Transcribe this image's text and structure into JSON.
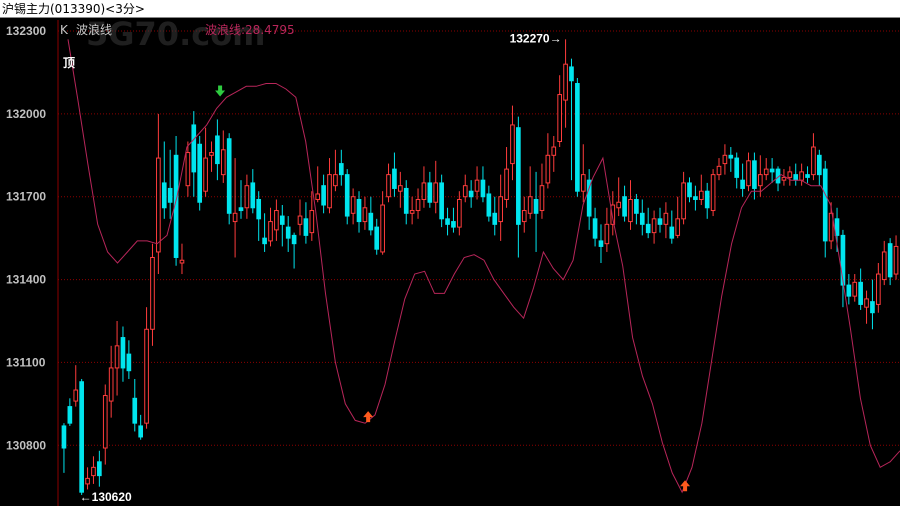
{
  "window": {
    "title": "沪锡主力(013390)<3分>"
  },
  "legend": {
    "k_label": "K",
    "indicator_name": "波浪线",
    "indicator_value_text": "波浪线:28.4795"
  },
  "watermark": "5G70.com",
  "colors": {
    "bg": "#000000",
    "up": "#ff3c3c",
    "down": "#00e5ee",
    "wave": "#b8265a",
    "grid": "#8b0000",
    "arrow_up": "#ff5a1e",
    "arrow_sell": "#2ecc40"
  },
  "signals": {
    "top_label": "顶",
    "buy_icon": "arrow-up-orange-icon",
    "sell_icon": "arrow-down-green-icon"
  },
  "chart_data": {
    "type": "candlestick",
    "yaxis": {
      "ticks": [
        132300,
        132000,
        131700,
        131400,
        131100,
        130800
      ],
      "ylim": [
        130580,
        132340
      ]
    },
    "annotations": {
      "high_text": "132270→",
      "high_value": 132270,
      "low_text": "←130620",
      "low_value": 130620
    },
    "candles": [
      [
        130870,
        130790,
        130880,
        130700
      ],
      [
        130940,
        130880,
        130970,
        130870
      ],
      [
        130960,
        131000,
        131090,
        130940
      ],
      [
        131030,
        130630,
        131040,
        130620
      ],
      [
        130660,
        130680,
        130720,
        130640
      ],
      [
        130690,
        130720,
        130760,
        130660
      ],
      [
        130740,
        130690,
        130780,
        130650
      ],
      [
        130790,
        130980,
        131020,
        130730
      ],
      [
        130960,
        131080,
        131160,
        130900
      ],
      [
        131080,
        131160,
        131250,
        130980
      ],
      [
        131190,
        131080,
        131230,
        131030
      ],
      [
        131130,
        131070,
        131180,
        131040
      ],
      [
        130970,
        130880,
        131040,
        130850
      ],
      [
        130870,
        130830,
        130910,
        130820
      ],
      [
        130880,
        131220,
        131300,
        130860
      ],
      [
        131220,
        131480,
        131530,
        131160
      ],
      [
        131500,
        131840,
        132000,
        131420
      ],
      [
        131750,
        131660,
        131900,
        131620
      ],
      [
        131730,
        131680,
        131870,
        131620
      ],
      [
        131850,
        131480,
        131920,
        131450
      ],
      [
        131460,
        131470,
        131530,
        131420
      ],
      [
        131740,
        131860,
        131900,
        131700
      ],
      [
        131960,
        131790,
        132010,
        131700
      ],
      [
        131890,
        131680,
        131920,
        131650
      ],
      [
        131720,
        131840,
        131950,
        131700
      ],
      [
        131850,
        131860,
        131900,
        131790
      ],
      [
        131920,
        131820,
        131980,
        131760
      ],
      [
        131780,
        131870,
        131940,
        131750
      ],
      [
        131910,
        131640,
        131930,
        131600
      ],
      [
        131610,
        131640,
        131840,
        131480
      ],
      [
        131660,
        131650,
        131760,
        131620
      ],
      [
        131660,
        131740,
        131780,
        131620
      ],
      [
        131750,
        131660,
        131800,
        131640
      ],
      [
        131690,
        131620,
        131720,
        131540
      ],
      [
        131550,
        131530,
        131640,
        131500
      ],
      [
        131540,
        131610,
        131660,
        131520
      ],
      [
        131580,
        131650,
        131690,
        131540
      ],
      [
        131630,
        131600,
        131670,
        131520
      ],
      [
        131590,
        131550,
        131630,
        131500
      ],
      [
        131560,
        131530,
        131570,
        131440
      ],
      [
        131600,
        131630,
        131690,
        131560
      ],
      [
        131620,
        131560,
        131680,
        131530
      ],
      [
        131570,
        131650,
        131720,
        131540
      ],
      [
        131690,
        131710,
        131810,
        131680
      ],
      [
        131740,
        131670,
        131780,
        131640
      ],
      [
        131660,
        131780,
        131840,
        131640
      ],
      [
        131740,
        131780,
        131870,
        131720
      ],
      [
        131820,
        131780,
        131870,
        131740
      ],
      [
        131780,
        131630,
        131800,
        131600
      ],
      [
        131640,
        131700,
        131730,
        131600
      ],
      [
        131690,
        131610,
        131720,
        131570
      ],
      [
        131610,
        131660,
        131700,
        131580
      ],
      [
        131640,
        131580,
        131700,
        131560
      ],
      [
        131590,
        131510,
        131620,
        131490
      ],
      [
        131500,
        131670,
        131720,
        131490
      ],
      [
        131700,
        131780,
        131820,
        131680
      ],
      [
        131800,
        131730,
        131860,
        131700
      ],
      [
        131720,
        131740,
        131790,
        131660
      ],
      [
        131730,
        131640,
        131760,
        131600
      ],
      [
        131640,
        131650,
        131700,
        131600
      ],
      [
        131650,
        131690,
        131730,
        131620
      ],
      [
        131690,
        131750,
        131810,
        131660
      ],
      [
        131750,
        131680,
        131790,
        131660
      ],
      [
        131680,
        131750,
        131830,
        131640
      ],
      [
        131750,
        131620,
        131780,
        131590
      ],
      [
        131620,
        131600,
        131660,
        131560
      ],
      [
        131610,
        131590,
        131660,
        131570
      ],
      [
        131590,
        131690,
        131720,
        131560
      ],
      [
        131700,
        131740,
        131780,
        131680
      ],
      [
        131720,
        131700,
        131760,
        131660
      ],
      [
        131720,
        131760,
        131810,
        131690
      ],
      [
        131760,
        131700,
        131810,
        131680
      ],
      [
        131710,
        131630,
        131740,
        131610
      ],
      [
        131640,
        131600,
        131700,
        131560
      ],
      [
        131610,
        131700,
        131780,
        131540
      ],
      [
        131690,
        131800,
        131880,
        131660
      ],
      [
        131820,
        131960,
        132030,
        131760
      ],
      [
        131950,
        131600,
        131990,
        131480
      ],
      [
        131610,
        131650,
        131700,
        131570
      ],
      [
        131640,
        131700,
        131810,
        131620
      ],
      [
        131690,
        131640,
        131790,
        131500
      ],
      [
        131650,
        131740,
        131820,
        131620
      ],
      [
        131750,
        131850,
        131930,
        131730
      ],
      [
        131850,
        131880,
        131920,
        131790
      ],
      [
        131900,
        132070,
        132140,
        131880
      ],
      [
        132050,
        132180,
        132270,
        131950
      ],
      [
        132170,
        132120,
        132200,
        131760
      ],
      [
        132110,
        131720,
        132130,
        131700
      ],
      [
        131720,
        131780,
        131890,
        131680
      ],
      [
        131760,
        131630,
        131800,
        131580
      ],
      [
        131620,
        131550,
        131660,
        131520
      ],
      [
        131540,
        131520,
        131600,
        131460
      ],
      [
        131530,
        131600,
        131660,
        131500
      ],
      [
        131600,
        131670,
        131720,
        131560
      ],
      [
        131660,
        131680,
        131770,
        131630
      ],
      [
        131700,
        131630,
        131740,
        131610
      ],
      [
        131610,
        131690,
        131760,
        131580
      ],
      [
        131690,
        131640,
        131710,
        131600
      ],
      [
        131640,
        131600,
        131690,
        131560
      ],
      [
        131600,
        131570,
        131660,
        131550
      ],
      [
        131570,
        131620,
        131650,
        131530
      ],
      [
        131620,
        131600,
        131660,
        131570
      ],
      [
        131600,
        131640,
        131680,
        131550
      ],
      [
        131590,
        131550,
        131650,
        131530
      ],
      [
        131560,
        131620,
        131700,
        131550
      ],
      [
        131620,
        131750,
        131790,
        131600
      ],
      [
        131750,
        131700,
        131770,
        131680
      ],
      [
        131700,
        131690,
        131740,
        131650
      ],
      [
        131690,
        131720,
        131780,
        131670
      ],
      [
        131720,
        131660,
        131750,
        131620
      ],
      [
        131650,
        131780,
        131800,
        131630
      ],
      [
        131780,
        131810,
        131840,
        131760
      ],
      [
        131820,
        131850,
        131890,
        131780
      ],
      [
        131850,
        131840,
        131880,
        131790
      ],
      [
        131840,
        131770,
        131860,
        131730
      ],
      [
        131760,
        131730,
        131820,
        131700
      ],
      [
        131740,
        131830,
        131860,
        131720
      ],
      [
        131830,
        131730,
        131860,
        131690
      ],
      [
        131740,
        131780,
        131850,
        131700
      ],
      [
        131780,
        131800,
        131840,
        131760
      ],
      [
        131800,
        131790,
        131840,
        131750
      ],
      [
        131800,
        131750,
        131810,
        131720
      ],
      [
        131760,
        131770,
        131800,
        131740
      ],
      [
        131770,
        131790,
        131810,
        131740
      ],
      [
        131780,
        131760,
        131820,
        131740
      ],
      [
        131760,
        131790,
        131820,
        131740
      ],
      [
        131780,
        131770,
        131810,
        131750
      ],
      [
        131780,
        131880,
        131930,
        131760
      ],
      [
        131850,
        131780,
        131870,
        131740
      ],
      [
        131800,
        131540,
        131830,
        131480
      ],
      [
        131540,
        131640,
        131680,
        131510
      ],
      [
        131620,
        131560,
        131660,
        131500
      ],
      [
        131560,
        131380,
        131580,
        131300
      ],
      [
        131380,
        131340,
        131420,
        131310
      ],
      [
        131340,
        131390,
        131420,
        131320
      ],
      [
        131390,
        131310,
        131440,
        131290
      ],
      [
        131300,
        131330,
        131360,
        131240
      ],
      [
        131320,
        131280,
        131400,
        131220
      ],
      [
        131310,
        131420,
        131460,
        131280
      ],
      [
        131400,
        131500,
        131540,
        131380
      ],
      [
        131530,
        131410,
        131550,
        131380
      ],
      [
        131420,
        131520,
        131560,
        131400
      ]
    ],
    "wave": [
      132270,
      132050,
      131820,
      131600,
      131500,
      131460,
      131500,
      131540,
      131540,
      131530,
      131560,
      131700,
      131880,
      131920,
      131960,
      132020,
      132060,
      132080,
      132100,
      132100,
      132110,
      132110,
      132090,
      132060,
      131900,
      131650,
      131350,
      131100,
      130950,
      130890,
      130880,
      130910,
      131020,
      131180,
      131330,
      131420,
      131430,
      131350,
      131350,
      131420,
      131480,
      131490,
      131470,
      131400,
      131350,
      131300,
      131260,
      131370,
      131500,
      131440,
      131400,
      131470,
      131670,
      131770,
      131840,
      131620,
      131450,
      131190,
      131050,
      130950,
      130810,
      130700,
      130630,
      130720,
      130880,
      131110,
      131340,
      131530,
      131660,
      131720,
      131720,
      131750,
      131780,
      131760,
      131760,
      131740,
      131740,
      131670,
      131450,
      131220,
      130970,
      130800,
      130720,
      130740,
      130780
    ]
  }
}
